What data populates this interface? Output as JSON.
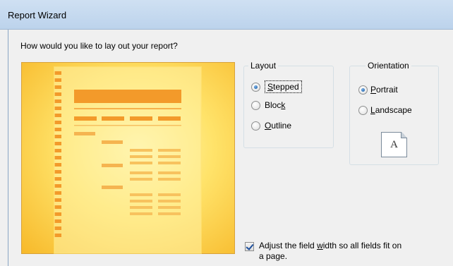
{
  "window": {
    "title": "Report Wizard"
  },
  "prompt": "How would you like to lay out your report?",
  "layout": {
    "legend": "Layout",
    "options": [
      {
        "label": "Stepped",
        "mnemonic": "S",
        "rest": "tepped",
        "checked": true
      },
      {
        "label": "Block",
        "mnemonic": "k",
        "checked": false
      },
      {
        "label": "Outline",
        "mnemonic": "O",
        "rest": "utline",
        "checked": false
      }
    ]
  },
  "orientation": {
    "legend": "Orientation",
    "options": [
      {
        "label": "Portrait",
        "mnemonic": "P",
        "rest": "ortrait",
        "checked": true
      },
      {
        "label": "Landscape",
        "mnemonic": "L",
        "rest": "andscape",
        "checked": false
      }
    ],
    "page_icon_letter": "A"
  },
  "adjust_width": {
    "label_line1_a": "Adjust the field ",
    "label_line1_u": "w",
    "label_line1_b": "idth so all fields fit on",
    "label_line2": "a page.",
    "checked": true
  },
  "colors": {
    "preview_border": "#d8a23a",
    "preview_accent": "#f39a2a",
    "radio_fill": "#2a6cb3"
  }
}
